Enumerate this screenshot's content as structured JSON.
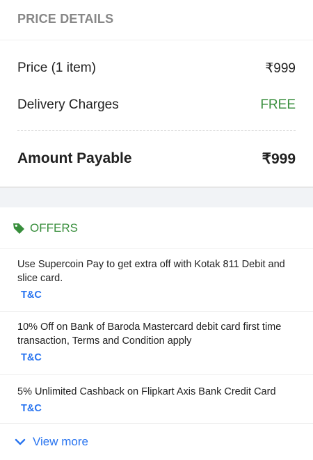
{
  "price_details": {
    "title": "PRICE DETAILS",
    "price_label": "Price (1 item)",
    "price_value": "₹999",
    "delivery_label": "Delivery Charges",
    "delivery_value": "FREE",
    "amount_label": "Amount Payable",
    "amount_value": "₹999"
  },
  "offers": {
    "title": "OFFERS",
    "tag_icon": "tag-icon",
    "items": [
      {
        "text": "Use Supercoin Pay to get extra off with Kotak 811 Debit and slice card.",
        "tc": "T&C"
      },
      {
        "text": "10% Off on Bank of Baroda Mastercard debit card first time transaction, Terms and Condition apply",
        "tc": "T&C"
      },
      {
        "text": "5% Unlimited Cashback on Flipkart Axis Bank Credit Card",
        "tc": "T&C"
      }
    ],
    "view_more": "View more"
  },
  "colors": {
    "accent_green": "#388e3c",
    "link_blue": "#2874f0",
    "header_grey": "#878787"
  }
}
